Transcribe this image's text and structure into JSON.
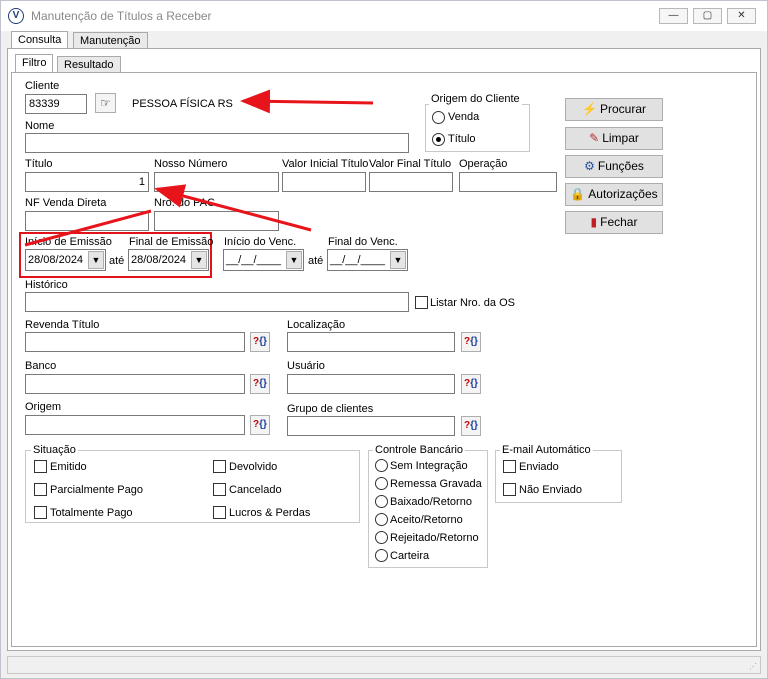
{
  "window": {
    "title": "Manutenção de Títulos a Receber",
    "controls": {
      "minimize": "—",
      "restore": "▢",
      "close": "✕"
    }
  },
  "tabs": [
    "Consulta",
    "Manutenção"
  ],
  "subtabs": [
    "Filtro",
    "Resultado"
  ],
  "form": {
    "cliente_label": "Cliente",
    "cliente_value": "83339",
    "cliente_name": "PESSOA FÍSICA  RS",
    "nome_label": "Nome",
    "titulo_label": "Título",
    "titulo_value": "1",
    "nosso_numero_label": "Nosso Número",
    "valor_inicial_label": "Valor Inicial Título",
    "valor_final_label": "Valor Final Título",
    "operacao_label": "Operação",
    "nf_venda_label": "NF Venda Direta",
    "nro_pac_label": "Nro. do PAC",
    "inicio_emissao_label": "Início de Emissão",
    "inicio_emissao_value": "28/08/2024",
    "ate1": "até",
    "final_emissao_label": "Final de Emissão",
    "final_emissao_value": "28/08/2024",
    "inicio_venc_label": "Início do Venc.",
    "inicio_venc_value": "__/__/____",
    "ate2": "até",
    "final_venc_label": "Final do Venc.",
    "final_venc_value": "__/__/____",
    "historico_label": "Histórico",
    "listar_os_label": "Listar Nro. da OS",
    "revenda_titulo_label": "Revenda Título",
    "localizacao_label": "Localização",
    "banco_label": "Banco",
    "usuario_label": "Usuário",
    "origem_label": "Origem",
    "grupo_clientes_label": "Grupo de clientes"
  },
  "origem_cliente": {
    "title": "Origem do Cliente",
    "options": [
      "Venda",
      "Título"
    ],
    "selected": "Título"
  },
  "buttons": {
    "procurar": "Procurar",
    "limpar": "Limpar",
    "funcoes": "Funções",
    "autorizacoes": "Autorizações",
    "fechar": "Fechar"
  },
  "situacao": {
    "title": "Situação",
    "items": [
      "Emitido",
      "Parcialmente Pago",
      "Totalmente Pago",
      "Devolvido",
      "Cancelado",
      "Lucros & Perdas"
    ]
  },
  "controle_bancario": {
    "title": "Controle Bancário",
    "options": [
      "Sem Integração",
      "Remessa Gravada",
      "Baixado/Retorno",
      "Aceito/Retorno",
      "Rejeitado/Retorno",
      "Carteira"
    ]
  },
  "email_automatico": {
    "title": "E-mail Automático",
    "items": [
      "Enviado",
      "Não Enviado"
    ]
  },
  "colors": {
    "annotation": "#e8141c",
    "highlight_border": "#e0121a"
  }
}
